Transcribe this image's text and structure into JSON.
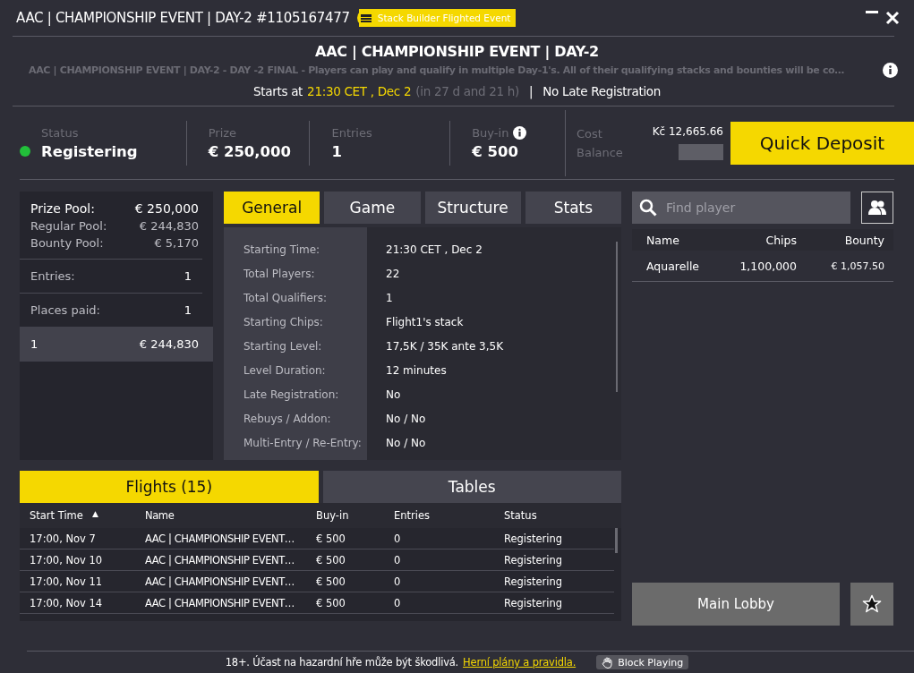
{
  "window": {
    "title": "AAC | CHAMPIONSHIP EVENT | DAY-2 #1105167477",
    "badge": "Stack Builder Flighted Event"
  },
  "header": {
    "title": "AAC | CHAMPIONSHIP EVENT | DAY-2",
    "description": "AAC | CHAMPIONSHIP EVENT | DAY-2 - DAY -2 FINAL - Players can play and qualify in multiple Day-1's. All of their qualifying stacks and bounties will be co…",
    "starts_label": "Starts at",
    "starts_time": "21:30 CET , Dec 2",
    "countdown": "(in 27 d and 21 h)",
    "separator": "|",
    "late_registration": "No Late Registration"
  },
  "stats": [
    {
      "label": "Status",
      "value": "Registering",
      "color": "#22c03a"
    },
    {
      "label": "Prize",
      "value": "€ 250,000"
    },
    {
      "label": "Entries",
      "value": "1"
    },
    {
      "label": "Buy-in",
      "value": "€ 500",
      "info": true
    }
  ],
  "account": {
    "cost_label": "Cost",
    "balance_label": "Balance",
    "cost": "Kč 12,665.66",
    "quick_deposit": "Quick Deposit"
  },
  "prize_panel": {
    "pools": [
      {
        "label": "Prize Pool:",
        "value": "€ 250,000",
        "kind": "main"
      },
      {
        "label": "Regular Pool:",
        "value": "€ 244,830",
        "kind": "sub"
      },
      {
        "label": "Bounty Pool:",
        "value": "€ 5,170",
        "kind": "sub"
      }
    ],
    "entries_label": "Entries:",
    "entries": "1",
    "places_label": "Places paid:",
    "places": "1",
    "payouts": [
      {
        "place": "1",
        "amount": "€ 244,830",
        "selected": true
      }
    ]
  },
  "info_tabs": [
    {
      "label": "General",
      "selected": true
    },
    {
      "label": "Game",
      "selected": false
    },
    {
      "label": "Structure",
      "selected": false
    },
    {
      "label": "Stats",
      "selected": false
    }
  ],
  "general": [
    {
      "label": "Starting Time:",
      "value": "21:30 CET , Dec 2"
    },
    {
      "label": "Total Players:",
      "value": "22"
    },
    {
      "label": "Total Qualifiers:",
      "value": "1"
    },
    {
      "label": "Starting Chips:",
      "value": "Flight1's stack"
    },
    {
      "label": "Starting Level:",
      "value": "17,5K / 35K ante 3,5K"
    },
    {
      "label": "Level Duration:",
      "value": "12 minutes"
    },
    {
      "label": "Late Registration:",
      "value": "No"
    },
    {
      "label": "Rebuys / Addon:",
      "value": "No / No"
    },
    {
      "label": "Multi-Entry / Re-Entry:",
      "value": "No / No"
    }
  ],
  "players": {
    "search": {
      "placeholder": "Find player"
    },
    "columns": [
      "Name",
      "Chips",
      "Bounty"
    ],
    "rows": [
      [
        "Aquarelle",
        "1,100,000",
        "€ 1,057.50"
      ]
    ]
  },
  "bottom_tabs": [
    {
      "label": "Flights (15)",
      "selected": true
    },
    {
      "label": "Tables",
      "selected": false
    }
  ],
  "flights": {
    "columns": [
      "Start Time",
      "Name",
      "Buy-in",
      "Entries",
      "Status"
    ],
    "sort_indicator": "▲",
    "rows": [
      [
        "17:00, Nov 7",
        "AAC | CHAMPIONSHIP EVENT…",
        "€ 500",
        "0",
        "Registering"
      ],
      [
        "17:00, Nov 10",
        "AAC | CHAMPIONSHIP EVENT…",
        "€ 500",
        "0",
        "Registering"
      ],
      [
        "17:00, Nov 11",
        "AAC | CHAMPIONSHIP EVENT…",
        "€ 500",
        "0",
        "Registering"
      ],
      [
        "17:00, Nov 14",
        "AAC | CHAMPIONSHIP EVENT…",
        "€ 500",
        "0",
        "Registering"
      ]
    ]
  },
  "main_lobby": "Main Lobby",
  "footer": {
    "notice": "18+. Účast na hazardní hře může být škodlivá.",
    "link": "Herní plány a pravidla.",
    "block_playing": "Block Playing"
  }
}
